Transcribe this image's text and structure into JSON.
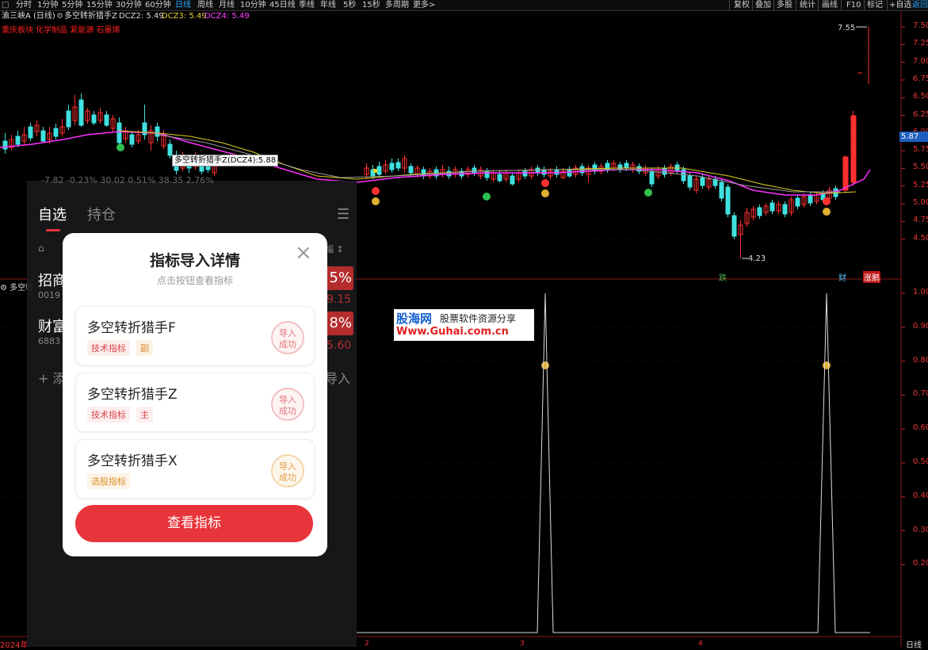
{
  "toolbar": {
    "items": [
      "分时",
      "1分钟",
      "5分钟",
      "15分钟",
      "30分钟",
      "60分钟",
      "日线",
      "周线",
      "月线",
      "10分钟",
      "45日线",
      "季线",
      "年线",
      "5秒",
      "15秒",
      "多周期",
      "更多>"
    ],
    "active_index": 6,
    "right_items": [
      "复权",
      "叠加",
      "多股",
      "统计",
      "画线",
      "F10",
      "标记",
      "+自选",
      "返回"
    ]
  },
  "info": {
    "stock": "渝三峡A (日线)",
    "indicator": "多空转折猎手Z",
    "dcz2": "DCZ2: 5.49",
    "dcz3": "DCZ3: 5.49",
    "dcz4": "DCZ4: 5.49",
    "sectors": "重庆板块 化学制品 紧能源 石墨烯"
  },
  "chart": {
    "price_axis": [
      "7.50",
      "7.25",
      "7.00",
      "6.75",
      "6.50",
      "6.25",
      "6.00",
      "5.75",
      "5.50",
      "5.25",
      "5.00",
      "4.75",
      "4.50"
    ],
    "current_price": "5.87",
    "high_label": "7.55",
    "low_label": "4.23",
    "tooltip": "多空转折猎手Z(DCZ4):5.88",
    "markers": {
      "die": "跌",
      "cai": "财",
      "zhang": "涨鹅"
    },
    "lower_panel_title": "多空转",
    "lower_axis": [
      "1.00",
      "0.90",
      "0.80",
      "0.70",
      "0.60",
      "0.50",
      "0.40",
      "0.30",
      "0.20"
    ],
    "x_ticks": [
      "2",
      "3",
      "4"
    ],
    "date_label": "2024年",
    "bottom_right": "日线"
  },
  "phone": {
    "tabs": {
      "zixuan": "自选",
      "chicang": "持仓"
    },
    "row_top": "-7.82  -0.23%      30.02  0.51%      38.35  2.76%",
    "stock1": {
      "name": "招商",
      "code": "0019",
      "pct": "5%",
      "price": "9.15"
    },
    "stock2": {
      "name": "财富",
      "code": "6883",
      "pct": "8%",
      "price": "5.60"
    },
    "add": "+ 添",
    "import": "导入",
    "amount_label": "幅 ↕"
  },
  "modal": {
    "title": "指标导入详情",
    "subtitle": "点击按钮查看指标",
    "cards": [
      {
        "name": "多空转折猎手F",
        "tag1": "技术指标",
        "tag2": "副",
        "seal": "导入\n成功"
      },
      {
        "name": "多空转折猎手Z",
        "tag1": "技术指标",
        "tag2": "主",
        "seal": "导入\n成功"
      },
      {
        "name": "多空转折猎手X",
        "tag1": "选股指标",
        "tag2": "",
        "seal": "导入\n成功"
      }
    ],
    "button": "查看指标",
    "close": "×"
  },
  "watermark": {
    "line1a": "股海网",
    "line1b": "股票软件资源分享",
    "line2": "Www.Guhai.com.cn"
  },
  "colors": {
    "up": "#ff3030",
    "down": "#40e0e0",
    "ma_magenta": "#ff30ff",
    "ma_yellow": "#e0d020",
    "accent_red": "#e8343b"
  }
}
